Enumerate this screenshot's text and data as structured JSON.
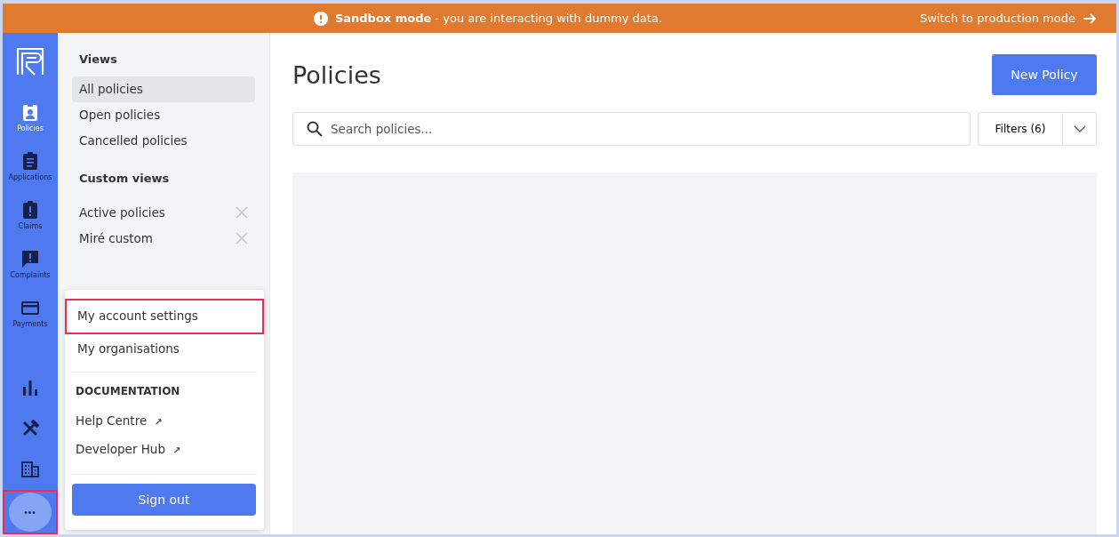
{
  "banner": {
    "title": "Sandbox mode",
    "message": " - you are interacting with dummy data.",
    "action": "Switch to production mode"
  },
  "rail": {
    "items": [
      {
        "label": "Policies",
        "kind": "badge",
        "selected": true
      },
      {
        "label": "Applications",
        "kind": "clipboard",
        "selected": false
      },
      {
        "label": "Claims",
        "kind": "alert",
        "selected": false
      },
      {
        "label": "Complaints",
        "kind": "chat",
        "selected": false
      },
      {
        "label": "Payments",
        "kind": "card",
        "selected": false
      }
    ],
    "tools": [
      {
        "kind": "chart"
      },
      {
        "kind": "tools"
      },
      {
        "kind": "building"
      }
    ],
    "more": {
      "label": "•••",
      "highlighted": true
    }
  },
  "views": {
    "heading": "Views",
    "items": [
      {
        "label": "All policies",
        "selected": true
      },
      {
        "label": "Open policies",
        "selected": false
      },
      {
        "label": "Cancelled policies",
        "selected": false
      }
    ],
    "custom_heading": "Custom views",
    "custom_items": [
      {
        "label": "Active policies",
        "selected": false
      },
      {
        "label": "Miré custom",
        "selected": false
      }
    ]
  },
  "menu": {
    "items": [
      {
        "label": "My account settings",
        "highlighted": true
      },
      {
        "label": "My organisations",
        "highlighted": false
      }
    ],
    "section": "DOCUMENTATION",
    "links": [
      {
        "label": "Help Centre",
        "external": "↗"
      },
      {
        "label": "Developer Hub",
        "external": "↗"
      }
    ],
    "sign_out": "Sign out"
  },
  "main": {
    "title": "Policies",
    "new_button": "New Policy",
    "search": {
      "placeholder": "Search policies..."
    },
    "filters": "Filters (6)"
  }
}
